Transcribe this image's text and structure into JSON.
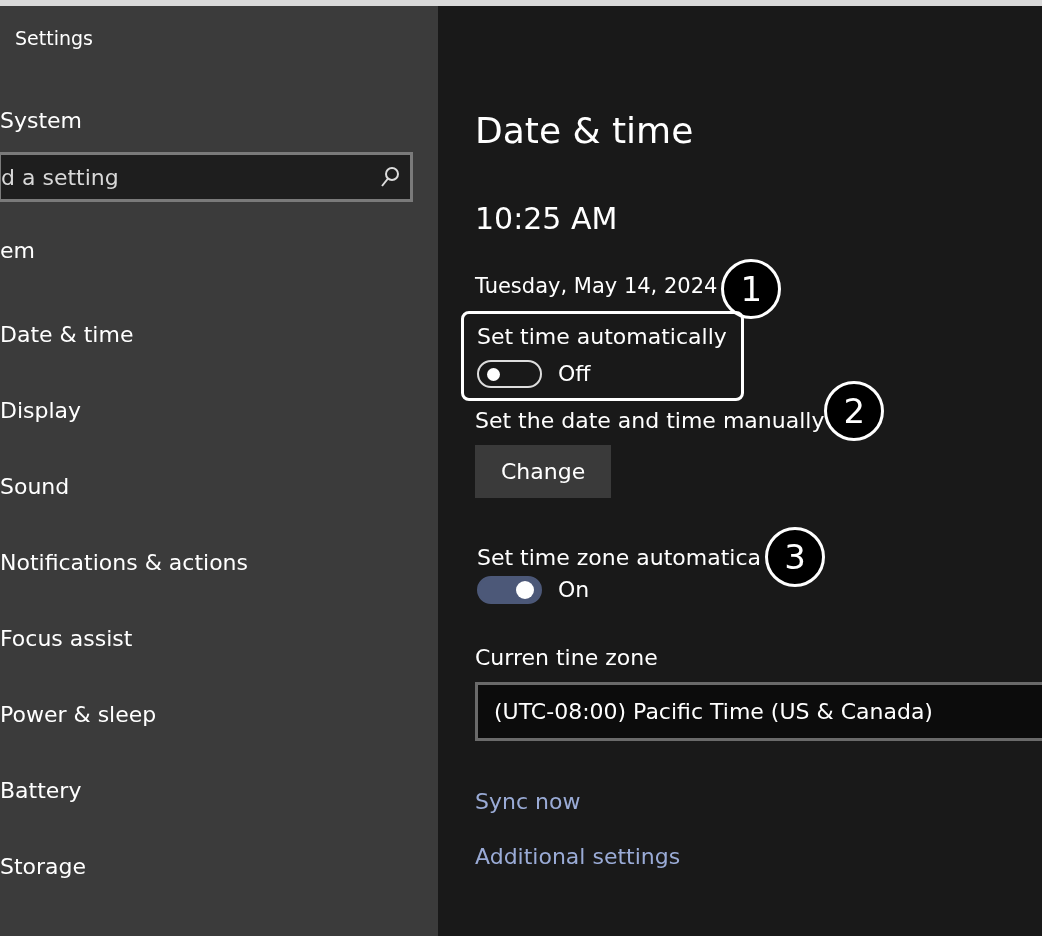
{
  "window": {
    "title": "Settings"
  },
  "sidebar": {
    "header": "System",
    "search": {
      "placeholder": "d a setting"
    },
    "section": "em",
    "items": [
      {
        "label": "Date & time"
      },
      {
        "label": "Display"
      },
      {
        "label": "Sound"
      },
      {
        "label": "Notifications & actions"
      },
      {
        "label": "Focus assist"
      },
      {
        "label": "Power & sleep"
      },
      {
        "label": "Battery"
      },
      {
        "label": "Storage"
      }
    ]
  },
  "page": {
    "title": "Date & time",
    "time": "10:25 AM",
    "date": "Tuesday, May 14, 2024",
    "date_callout": "1",
    "settings": [
      {
        "kind": "toggle",
        "label": "Set time automatically",
        "on": false,
        "state_text": "Off",
        "highlighted": true
      },
      {
        "kind": "button",
        "label": "Set the date and time manually",
        "callout": "2",
        "button": "Change"
      },
      {
        "kind": "toggle",
        "label": "Set time zone automatica",
        "callout": "3",
        "on": true,
        "state_text": "On",
        "highlighted": false
      },
      {
        "kind": "select",
        "label": "Curren tine zone",
        "value": "(UTC-08:00) Pacific Time (US & Canada)"
      }
    ],
    "links": [
      "Sync now",
      "Additional settings"
    ]
  }
}
